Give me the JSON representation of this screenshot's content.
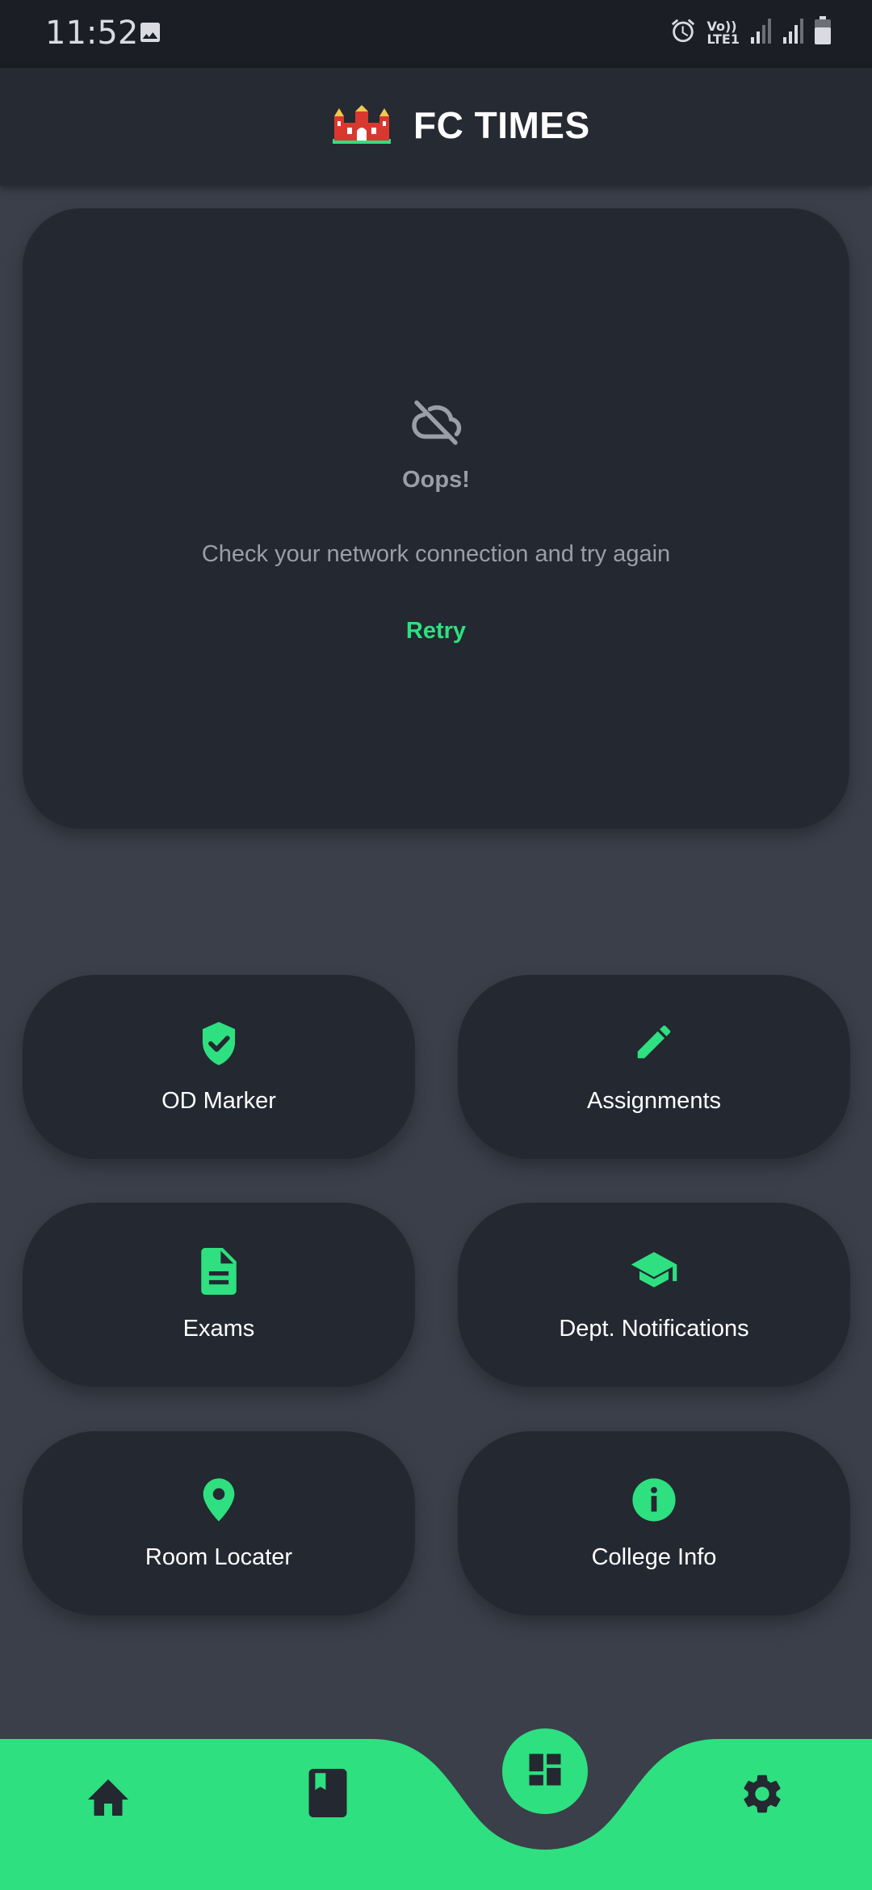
{
  "status_bar": {
    "time": "11:52",
    "gallery_icon": "image-icon",
    "alarm_icon": "alarm-icon",
    "volte_top": "Vo))",
    "volte_bottom": "LTE1",
    "signal_icon": "signal-icon",
    "battery_icon": "battery-icon"
  },
  "header": {
    "logo_icon": "college-gate-logo",
    "title": "FC TIMES"
  },
  "error_card": {
    "icon": "cloud-off-icon",
    "title": "Oops!",
    "message": "Check your network connection and try again",
    "retry_label": "Retry"
  },
  "tiles": [
    {
      "label": "OD Marker",
      "icon": "shield-check-icon"
    },
    {
      "label": "Assignments",
      "icon": "pencil-icon"
    },
    {
      "label": "Exams",
      "icon": "document-icon"
    },
    {
      "label": "Dept. Notifications",
      "icon": "graduation-cap-icon"
    },
    {
      "label": "Room Locater",
      "icon": "location-pin-icon"
    },
    {
      "label": "College Info",
      "icon": "info-icon"
    }
  ],
  "bottom_nav": {
    "items": [
      "home-icon",
      "book-icon",
      "dashboard-icon",
      "settings-icon"
    ]
  },
  "colors": {
    "accent": "#2ee07f",
    "background": "#3a3f4a",
    "card": "#232831",
    "header": "#252a33",
    "status_bar": "#1b1e25"
  }
}
